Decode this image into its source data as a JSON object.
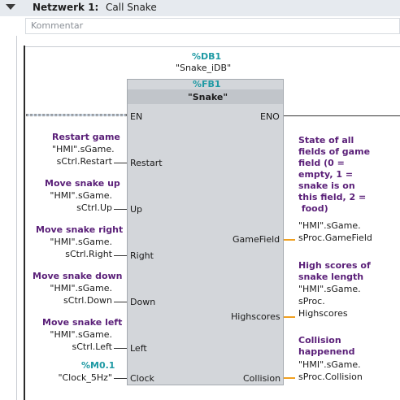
{
  "network": {
    "title": "Netzwerk 1:",
    "name": "Call Snake",
    "comment_placeholder": "Kommentar"
  },
  "block": {
    "instance_address": "%DB1",
    "instance_name": "\"Snake_iDB\"",
    "fb_address": "%FB1",
    "fb_name": "\"Snake\""
  },
  "inputs": [
    {
      "pin": "EN",
      "comment": "",
      "operand_lines": []
    },
    {
      "pin": "Restart",
      "comment": "Restart game",
      "operand_lines": [
        "\"HMI\".sGame.",
        "sCtrl.Restart"
      ]
    },
    {
      "pin": "Up",
      "comment": "Move snake up",
      "operand_lines": [
        "\"HMI\".sGame.",
        "sCtrl.Up"
      ]
    },
    {
      "pin": "Right",
      "comment": "Move snake right",
      "operand_lines": [
        "\"HMI\".sGame.",
        "sCtrl.Right"
      ]
    },
    {
      "pin": "Down",
      "comment": "Move snake down",
      "operand_lines": [
        "\"HMI\".sGame.",
        "sCtrl.Down"
      ]
    },
    {
      "pin": "Left",
      "comment": "Move snake left",
      "operand_lines": [
        "\"HMI\".sGame.",
        "sCtrl.Left"
      ]
    },
    {
      "pin": "Clock",
      "comment": "%M0.1",
      "operand_lines": [
        "\"Clock_5Hz\""
      ]
    }
  ],
  "outputs": [
    {
      "pin": "ENO",
      "comment_lines": [],
      "operand_lines": []
    },
    {
      "pin": "GameField",
      "comment_lines": [
        "State of all",
        "fields of game",
        "field (0 =",
        "empty, 1 =",
        "snake is on",
        "this field, 2 =",
        " food)"
      ],
      "operand_lines": [
        "\"HMI\".sGame.",
        "sProc.GameField"
      ]
    },
    {
      "pin": "Highscores",
      "comment_lines": [
        "High scores of",
        "snake length"
      ],
      "operand_lines": [
        "\"HMI\".sGame.",
        "sProc.",
        "Highscores"
      ]
    },
    {
      "pin": "Collision",
      "comment_lines": [
        "Collision",
        "happenend"
      ],
      "operand_lines": [
        "\"HMI\".sGame.",
        "sProc.Collision"
      ]
    }
  ],
  "colors": {
    "address_teal": "#1f9aa4",
    "comment_purple": "#5a1f78",
    "output_wire_orange": "#f0a020",
    "block_fill": "#d3d6da"
  }
}
